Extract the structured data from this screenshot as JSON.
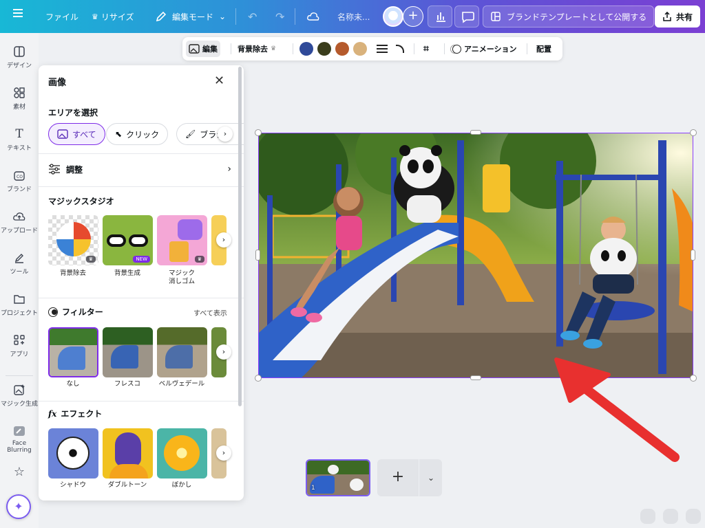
{
  "topbar": {
    "file": "ファイル",
    "resize": "リサイズ",
    "edit_mode": "編集モード",
    "doc_name": "名称未...",
    "publish": "ブランドテンプレートとして公開する",
    "share": "共有"
  },
  "rail": [
    {
      "label": "デザイン",
      "icon": "layout-icon"
    },
    {
      "label": "素材",
      "icon": "shapes-icon"
    },
    {
      "label": "テキスト",
      "icon": "text-icon"
    },
    {
      "label": "ブランド",
      "icon": "brand-icon"
    },
    {
      "label": "アップロード",
      "icon": "upload-icon"
    },
    {
      "label": "ツール",
      "icon": "draw-icon"
    },
    {
      "label": "プロジェクト",
      "icon": "folder-icon"
    },
    {
      "label": "アプリ",
      "icon": "apps-icon"
    },
    {
      "label": "マジック生成",
      "icon": "magic-media-icon"
    },
    {
      "label": "Face Blurring",
      "icon": "face-blur-icon"
    }
  ],
  "panel": {
    "title": "画像",
    "select_area": "エリアを選択",
    "chips": [
      "すべて",
      "クリック",
      "ブラシ"
    ],
    "adjust": "調整",
    "magic_studio": "マジックスタジオ",
    "magic_items": [
      {
        "label": "背景除去",
        "badge": "crown"
      },
      {
        "label": "背景生成",
        "badge": "NEW"
      },
      {
        "label": "マジック\n消しゴム",
        "badge": "crown"
      }
    ],
    "filters_title": "フィルター",
    "show_all": "すべて表示",
    "filters": [
      "なし",
      "フレスコ",
      "ベルヴェデール"
    ],
    "effects_title": "エフェクト",
    "effects": [
      "シャドウ",
      "ダブルトーン",
      "ぼかし"
    ]
  },
  "context_toolbar": {
    "edit": "編集",
    "bg_remove": "背景除去",
    "colors": [
      "#2f4a99",
      "#3a3d1c",
      "#b55a2c",
      "#d9b27c"
    ],
    "animation": "アニメーション",
    "position": "配置"
  },
  "pages": {
    "current": "1"
  },
  "colors": {
    "accent": "#7d2ae8",
    "arrow": "#e8302f"
  }
}
